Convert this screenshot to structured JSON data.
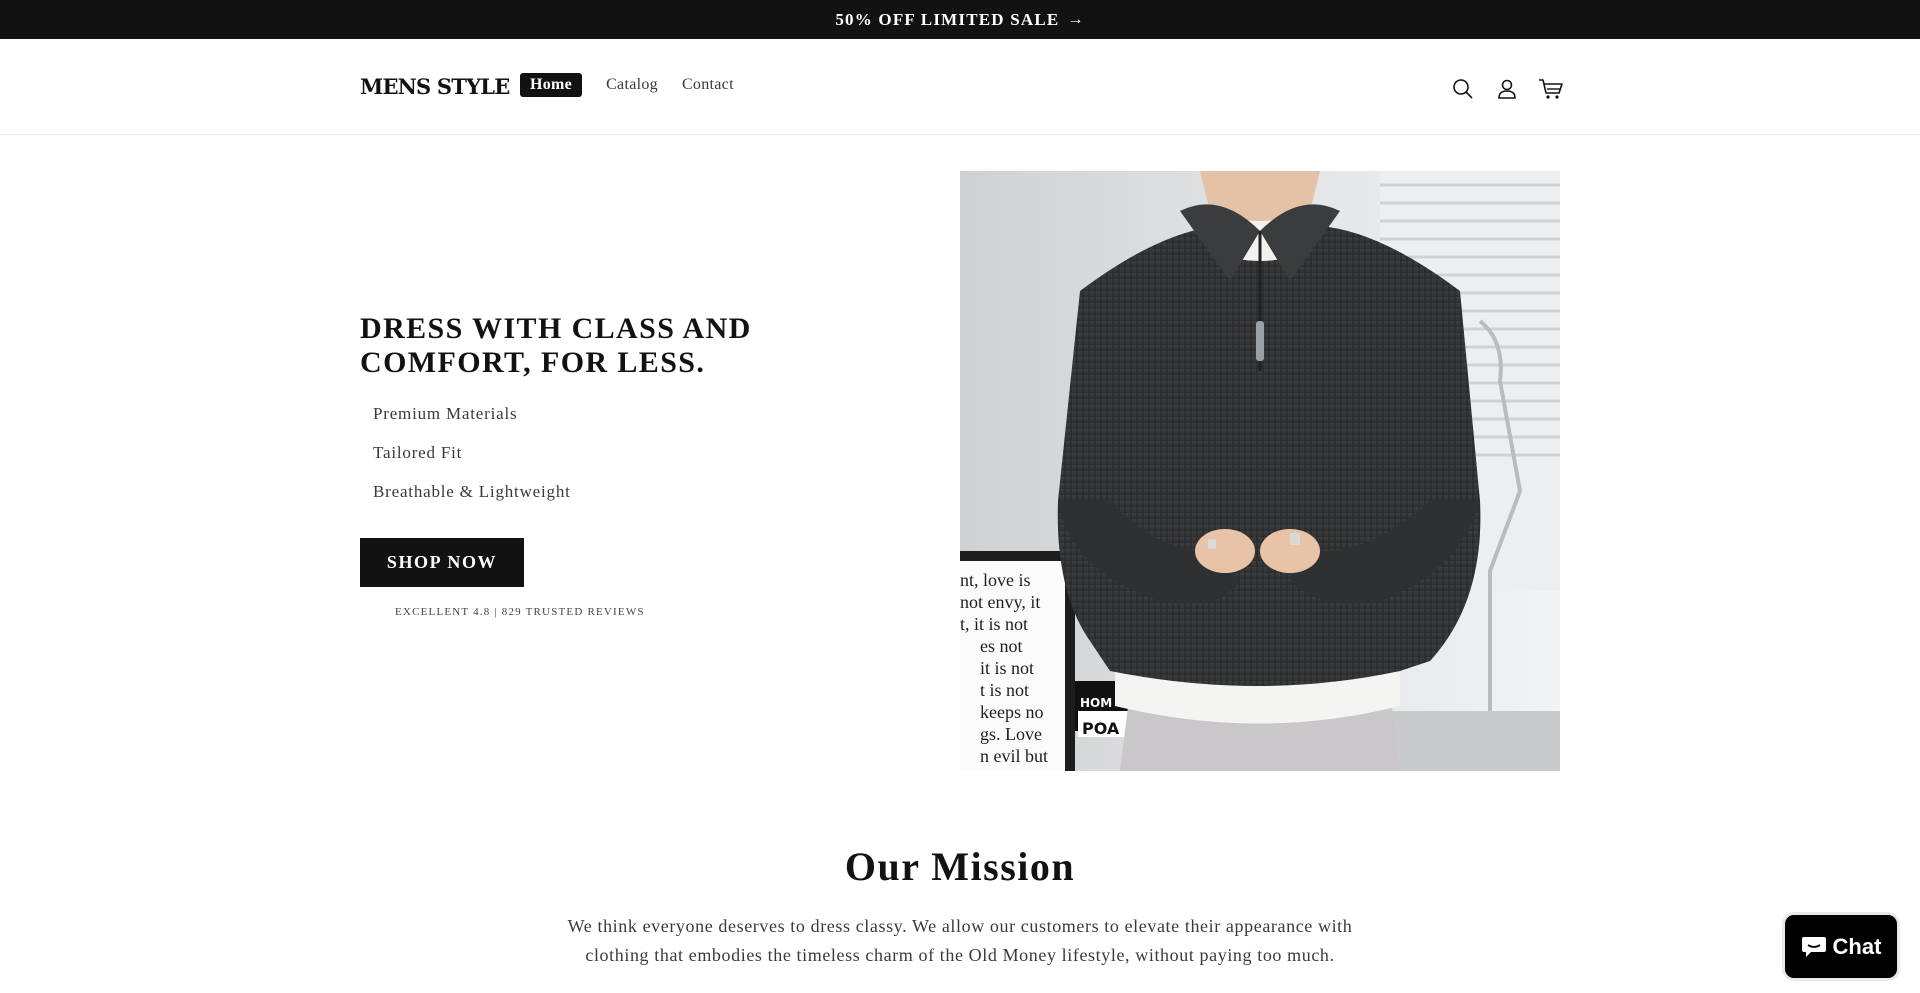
{
  "announcement": {
    "text": "50% OFF LIMITED SALE",
    "arrow": "→"
  },
  "header": {
    "logo": "MENS STYLE",
    "nav": [
      {
        "label": "Home",
        "active": true
      },
      {
        "label": "Catalog",
        "active": false
      },
      {
        "label": "Contact",
        "active": false
      }
    ],
    "icons": [
      "search-icon",
      "account-icon",
      "cart-icon"
    ]
  },
  "hero": {
    "title": "DRESS WITH CLASS AND COMFORT, FOR LESS.",
    "features": [
      "Premium Materials",
      "Tailored Fit",
      "Breathable & Lightweight"
    ],
    "cta": "SHOP NOW",
    "reviews": "EXCELLENT 4.8 | 829 TRUSTED REVIEWS",
    "poster_lines": [
      "nt, love is",
      "not envy, it",
      "t, it is not",
      "es not",
      "it is not",
      "t is not",
      "keeps no",
      "gs. Love",
      "n evil but"
    ],
    "badge_lines": [
      "HOM",
      "POA"
    ]
  },
  "mission": {
    "title": "Our Mission",
    "text": "We think everyone deserves to dress classy. We allow our customers to elevate their appearance with clothing that embodies the timeless charm of the Old Money lifestyle, without paying too much."
  },
  "chat": {
    "label": "Chat"
  },
  "colors": {
    "primary": "#121212",
    "background": "#ffffff",
    "text_muted": "#3a3a3a"
  }
}
